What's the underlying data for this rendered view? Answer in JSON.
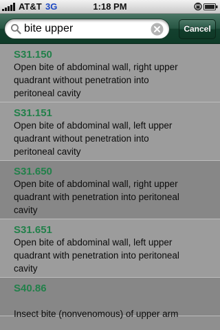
{
  "status_bar": {
    "carrier": "AT&T",
    "network": "3G",
    "time": "1:18 PM",
    "icons": [
      "signal-icon",
      "rotation-lock-icon",
      "battery-icon"
    ]
  },
  "search": {
    "query": "bite upper",
    "cancel_label": "Cancel"
  },
  "colors": {
    "header_green": "#1e4a37",
    "code_green": "#22804a",
    "row_light": "#9c9c9c",
    "row_dark": "#878787"
  },
  "results": [
    {
      "code": "S31.150",
      "description": "Open bite of abdominal wall, right upper\nquadrant without penetration into\nperitoneal cavity"
    },
    {
      "code": "S31.151",
      "description": "Open bite of abdominal wall, left upper\nquadrant without penetration into\nperitoneal cavity"
    },
    {
      "code": "S31.650",
      "description": "Open bite of abdominal wall, right upper\nquadrant with penetration into peritoneal\ncavity"
    },
    {
      "code": "S31.651",
      "description": "Open bite of abdominal wall, left upper\nquadrant with penetration into peritoneal\ncavity"
    },
    {
      "code": "S40.86",
      "description": "Insect bite (nonvenomous) of upper arm"
    }
  ]
}
